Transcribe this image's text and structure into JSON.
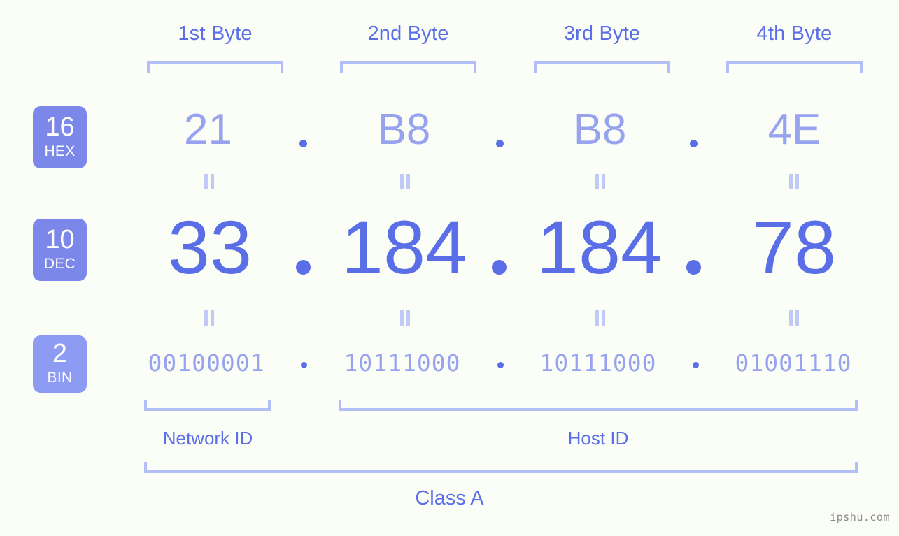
{
  "watermark": "ipshu.com",
  "byte_headers": [
    {
      "label": "1st Byte"
    },
    {
      "label": "2nd Byte"
    },
    {
      "label": "3rd Byte"
    },
    {
      "label": "4th Byte"
    }
  ],
  "rows": [
    {
      "base": "16",
      "base_name": "HEX",
      "values": [
        "21",
        "B8",
        "B8",
        "4E"
      ],
      "separator": "."
    },
    {
      "base": "10",
      "base_name": "DEC",
      "values": [
        "33",
        "184",
        "184",
        "78"
      ],
      "separator": "."
    },
    {
      "base": "2",
      "base_name": "BIN",
      "values": [
        "00100001",
        "10111000",
        "10111000",
        "01001110"
      ],
      "separator": "."
    }
  ],
  "equivalence_symbol": "=",
  "sections": [
    {
      "label": "Network ID"
    },
    {
      "label": "Host ID"
    }
  ],
  "class_label": "Class A",
  "colors": {
    "background": "#fbfdf7",
    "accent_strong": "#5a6ee8",
    "accent_light": "#97a3ef",
    "bracket": "#b3bdf6",
    "badge_primary": "#7b88ea",
    "badge_secondary": "#8e9bf2",
    "equals": "#c0c9f8",
    "watermark": "#8a8a8a"
  }
}
